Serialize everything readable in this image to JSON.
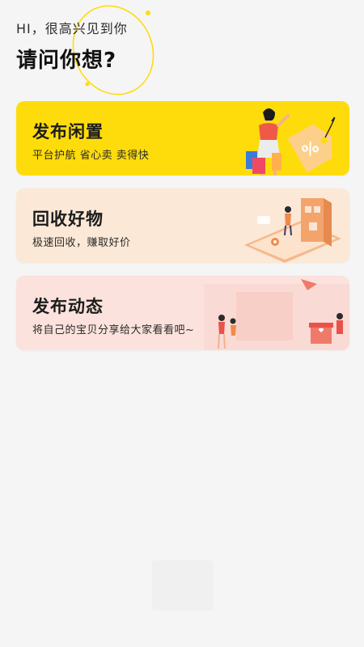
{
  "header": {
    "greeting": "HI，很高兴见到你",
    "question": "请问你想?"
  },
  "options": [
    {
      "title": "发布闲置",
      "subtitle": "平台护航  省心卖  卖得快",
      "art": "shopping-woman-sale-tag-illustration",
      "bg": "#fedc0c"
    },
    {
      "title": "回收好物",
      "subtitle": "极速回收，赚取好价",
      "art": "phone-recycle-illustration",
      "bg": "#fbe8d6"
    },
    {
      "title": "发布动态",
      "subtitle": "将自己的宝贝分享给大家看看吧~",
      "art": "people-sharing-illustration",
      "bg": "#fbe2dc"
    }
  ],
  "colors": {
    "page_bg": "#f5f5f6",
    "accent_yellow": "#fedc0c",
    "accent_orange": "#f08a4b"
  }
}
